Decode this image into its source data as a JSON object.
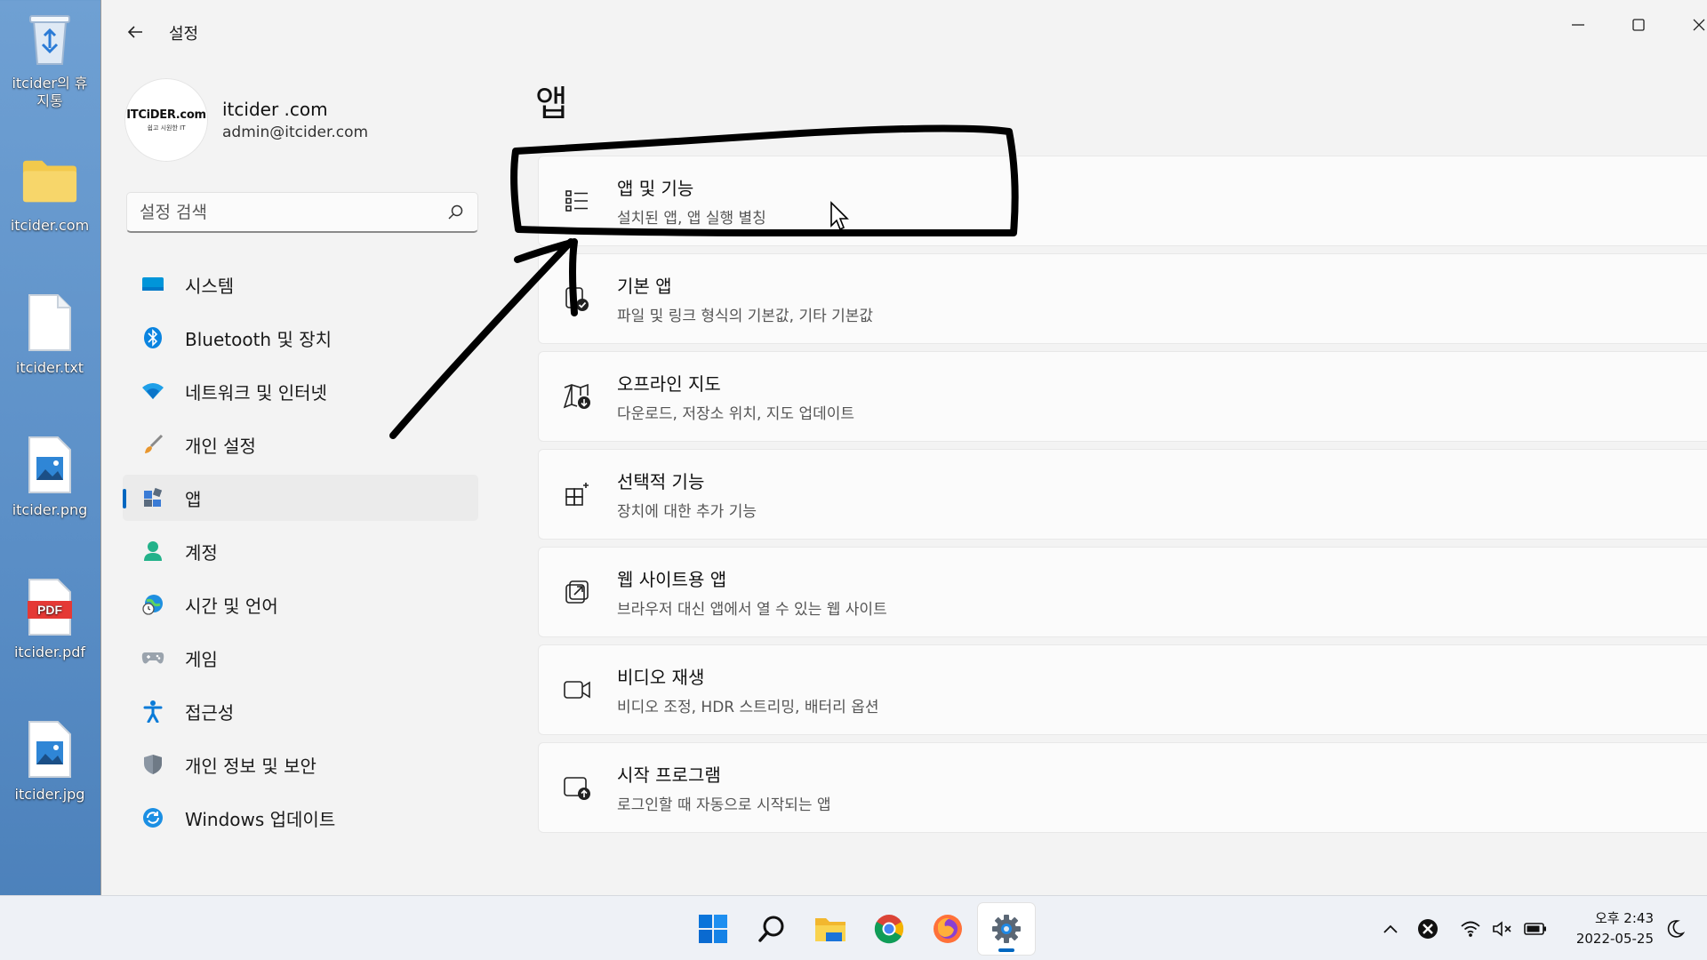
{
  "desktop": {
    "icons": [
      {
        "label": "itcider의 휴지통",
        "icon": "recycle-bin-icon"
      },
      {
        "label": "itcider.com",
        "icon": "folder-icon"
      },
      {
        "label": "itcider.txt",
        "icon": "text-file-icon"
      },
      {
        "label": "itcider.png",
        "icon": "image-file-icon"
      },
      {
        "label": "itcider.pdf",
        "icon": "pdf-file-icon"
      },
      {
        "label": "itcider.jpg",
        "icon": "image-file-icon"
      }
    ]
  },
  "window": {
    "title": "설정",
    "profile": {
      "avatar_text": "ITCiDER.com",
      "avatar_subtext": "쉽고 시원한 IT",
      "name": "itcider .com",
      "email": "admin@itcider.com"
    },
    "search": {
      "placeholder": "설정 검색"
    },
    "nav": [
      {
        "label": "시스템",
        "icon": "monitor-icon"
      },
      {
        "label": "Bluetooth 및 장치",
        "icon": "bluetooth-icon"
      },
      {
        "label": "네트워크 및 인터넷",
        "icon": "wifi-icon"
      },
      {
        "label": "개인 설정",
        "icon": "brush-icon"
      },
      {
        "label": "앱",
        "icon": "apps-icon",
        "active": true
      },
      {
        "label": "계정",
        "icon": "person-icon"
      },
      {
        "label": "시간 및 언어",
        "icon": "globe-clock-icon"
      },
      {
        "label": "게임",
        "icon": "gamepad-icon"
      },
      {
        "label": "접근성",
        "icon": "accessibility-icon"
      },
      {
        "label": "개인 정보 및 보안",
        "icon": "shield-icon"
      },
      {
        "label": "Windows 업데이트",
        "icon": "update-icon"
      }
    ],
    "page_title": "앱",
    "cards": [
      {
        "title": "앱 및 기능",
        "subtitle": "설치된 앱, 앱 실행 별칭",
        "icon": "list-icon"
      },
      {
        "title": "기본 앱",
        "subtitle": "파일 및 링크 형식의 기본값, 기타 기본값",
        "icon": "default-apps-icon"
      },
      {
        "title": "오프라인 지도",
        "subtitle": "다운로드, 저장소 위치, 지도 업데이트",
        "icon": "map-icon"
      },
      {
        "title": "선택적 기능",
        "subtitle": "장치에 대한 추가 기능",
        "icon": "optional-features-icon"
      },
      {
        "title": "웹 사이트용 앱",
        "subtitle": "브라우저 대신 앱에서 열 수 있는 웹 사이트",
        "icon": "open-external-icon"
      },
      {
        "title": "비디오 재생",
        "subtitle": "비디오 조정, HDR 스트리밍, 배터리 옵션",
        "icon": "video-icon"
      },
      {
        "title": "시작 프로그램",
        "subtitle": "로그인할 때 자동으로 시작되는 앱",
        "icon": "startup-icon"
      }
    ]
  },
  "taskbar": {
    "apps": [
      {
        "name": "start-button",
        "icon": "windows-logo-icon"
      },
      {
        "name": "search-button",
        "icon": "search-icon"
      },
      {
        "name": "file-explorer-button",
        "icon": "folder-icon"
      },
      {
        "name": "chrome-button",
        "icon": "chrome-icon"
      },
      {
        "name": "firefox-button",
        "icon": "firefox-icon"
      },
      {
        "name": "settings-button",
        "icon": "gear-icon",
        "active": true
      }
    ],
    "clock": {
      "time": "오후 2:43",
      "date": "2022-05-25"
    }
  },
  "colors": {
    "accent": "#0067c0",
    "annotation": "#000000"
  }
}
